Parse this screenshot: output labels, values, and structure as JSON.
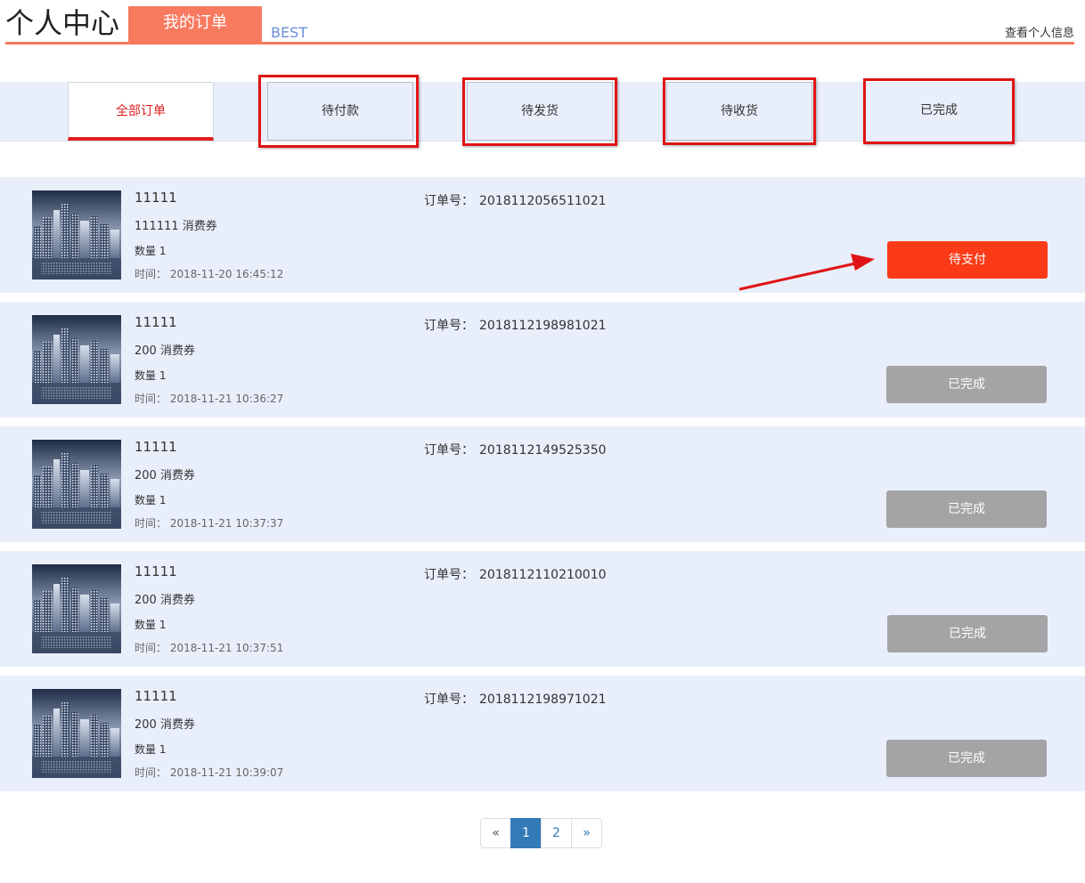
{
  "header": {
    "title": "个人中心",
    "active_tab": "我的订单",
    "brand": "BEST",
    "profile_link": "查看个人信息"
  },
  "tabs": [
    {
      "label": "全部订单",
      "active": true
    },
    {
      "label": "待付款",
      "active": false
    },
    {
      "label": "待发货",
      "active": false
    },
    {
      "label": "待收货",
      "active": false
    },
    {
      "label": "已完成",
      "active": false
    }
  ],
  "orders": [
    {
      "name": "11111",
      "desc": "111111 消费券",
      "qty": "数量 1",
      "time": "时间： 2018-11-20 16:45:12",
      "no_label": "订单号：",
      "no": "2018112056511021",
      "status": "待支付",
      "status_type": "pay"
    },
    {
      "name": "11111",
      "desc": "200 消费券",
      "qty": "数量 1",
      "time": "时间： 2018-11-21 10:36:27",
      "no_label": "订单号：",
      "no": "2018112198981021",
      "status": "已完成",
      "status_type": "done"
    },
    {
      "name": "11111",
      "desc": "200 消费券",
      "qty": "数量 1",
      "time": "时间： 2018-11-21 10:37:37",
      "no_label": "订单号：",
      "no": "2018112149525350",
      "status": "已完成",
      "status_type": "done"
    },
    {
      "name": "11111",
      "desc": "200 消费券",
      "qty": "数量 1",
      "time": "时间： 2018-11-21 10:37:51",
      "no_label": "订单号：",
      "no": "2018112110210010",
      "status": "已完成",
      "status_type": "done"
    },
    {
      "name": "11111",
      "desc": "200 消费券",
      "qty": "数量 1",
      "time": "时间： 2018-11-21 10:39:07",
      "no_label": "订单号：",
      "no": "2018112198971021",
      "status": "已完成",
      "status_type": "done"
    }
  ],
  "pagination": {
    "prev": "«",
    "pages": [
      "1",
      "2"
    ],
    "current": "1",
    "next": "»"
  },
  "colors": {
    "accent": "#f77a5f",
    "pay_button": "#fb3a18",
    "done_button": "#a4a3a5",
    "highlight": "#e01414",
    "row_bg": "#e9eefb"
  }
}
